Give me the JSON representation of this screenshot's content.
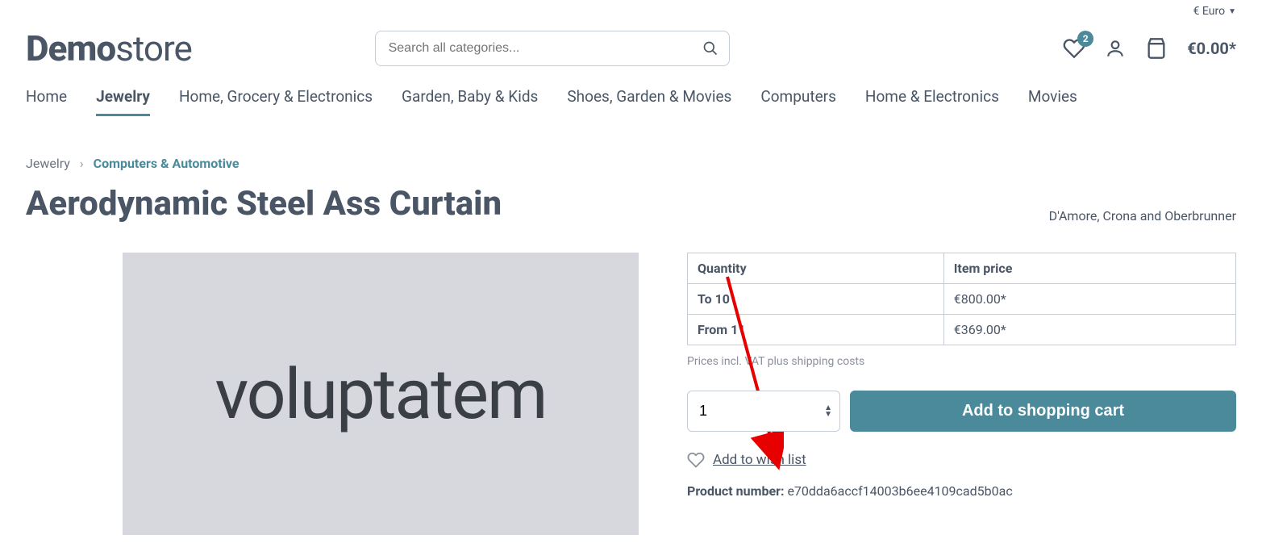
{
  "topbar": {
    "currency": "€ Euro"
  },
  "logo": {
    "bold": "Demo",
    "light": "store"
  },
  "search": {
    "placeholder": "Search all categories..."
  },
  "header_icons": {
    "wishlist_badge": "2",
    "cart_total": "€0.00*"
  },
  "nav": {
    "items": [
      {
        "label": "Home"
      },
      {
        "label": "Jewelry",
        "active": true
      },
      {
        "label": "Home, Grocery & Electronics"
      },
      {
        "label": "Garden, Baby & Kids"
      },
      {
        "label": "Shoes, Garden & Movies"
      },
      {
        "label": "Computers"
      },
      {
        "label": "Home & Electronics"
      },
      {
        "label": "Movies"
      }
    ]
  },
  "breadcrumb": {
    "parent": "Jewelry",
    "current": "Computers & Automotive"
  },
  "product": {
    "title": "Aerodynamic Steel Ass Curtain",
    "brand": "D'Amore, Crona and Oberbrunner",
    "image_text": "voluptatem"
  },
  "price_table": {
    "headers": {
      "qty": "Quantity",
      "price": "Item price"
    },
    "rows": [
      {
        "qty": "To 10",
        "price": "€800.00*"
      },
      {
        "qty": "From 11",
        "price": "€369.00*"
      }
    ]
  },
  "price_note": "Prices incl. VAT plus shipping costs",
  "buy": {
    "quantity": "1",
    "add_label": "Add to shopping cart",
    "wishlist_label": "Add to wish list"
  },
  "product_number": {
    "label": "Product number:",
    "value": "e70dda6accf14003b6ee4109cad5b0ac"
  }
}
